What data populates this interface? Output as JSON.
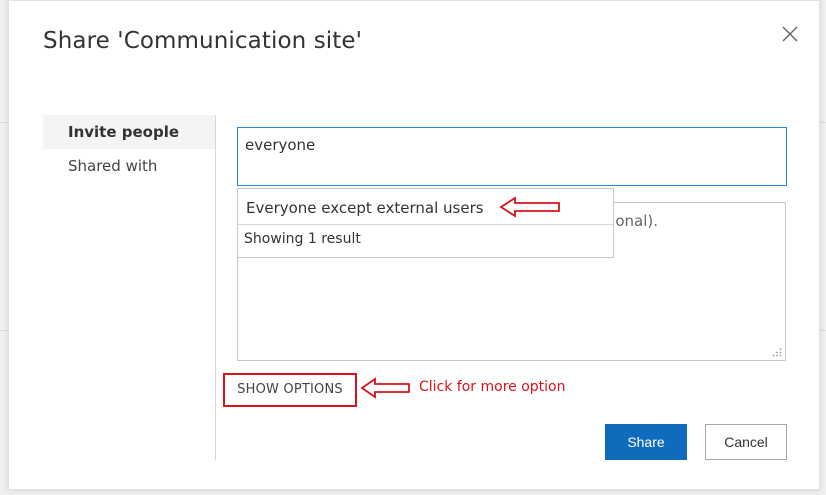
{
  "dialog": {
    "title": "Share 'Communication site'",
    "close_icon": "close-icon"
  },
  "nav": {
    "items": [
      {
        "label": "Invite people",
        "active": true
      },
      {
        "label": "Shared with",
        "active": false
      }
    ]
  },
  "people_picker": {
    "value": "everyone"
  },
  "suggestions": {
    "items": [
      {
        "label": "Everyone except external users"
      }
    ],
    "count_text": "Showing 1 result"
  },
  "message": {
    "placeholder_visible": "tional)."
  },
  "options": {
    "label": "SHOW OPTIONS"
  },
  "annotation": {
    "text": "Click for more option",
    "color": "#d9131a"
  },
  "buttons": {
    "share": "Share",
    "cancel": "Cancel"
  },
  "colors": {
    "accent": "#0f6cbd",
    "focus_border": "#2a8dd4",
    "annotation_red": "#d9131a"
  }
}
